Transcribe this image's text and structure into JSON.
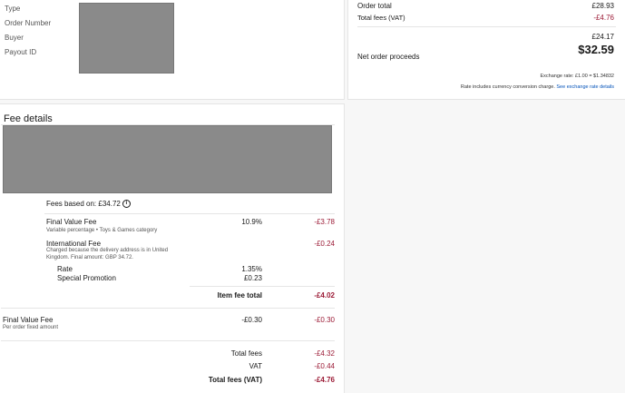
{
  "order_info": {
    "labels": {
      "type": "Type",
      "order_number": "Order Number",
      "buyer": "Buyer",
      "payout_id": "Payout ID"
    }
  },
  "summary": {
    "order_total_label": "Order total",
    "order_total_value": "£28.93",
    "total_fees_vat_label": "Total fees (VAT)",
    "total_fees_vat_value": "-£4.76",
    "subtotal_value": "£24.17",
    "net_proceeds_label": "Net order proceeds",
    "net_proceeds_value": "$32.59",
    "exchange_rate": "Exchange rate: £1.00 = $1.34832",
    "rate_note": "Rate includes currency conversion charge.",
    "rate_link": "See exchange rate details"
  },
  "fee_details": {
    "title": "Fee details",
    "fees_based_on": "Fees based on: £34.72",
    "final_value_fee": {
      "name": "Final Value Fee",
      "desc": "Variable percentage • Toys & Games category",
      "rate": "10.9%",
      "amount": "-£3.78"
    },
    "international_fee": {
      "name": "International Fee",
      "desc_line1": "Charged because the delivery address is in United",
      "desc_line2": "Kingdom. Final amount: GBP 34.72.",
      "amount": "-£0.24",
      "rate_label": "Rate",
      "rate_value": "1.35%",
      "promo_label": "Special Promotion",
      "promo_value": "£0.23"
    },
    "item_fee_total_label": "Item fee total",
    "item_fee_total_value": "-£4.02",
    "fixed_fee": {
      "name": "Final Value Fee",
      "desc": "Per order fixed amount",
      "rate": "-£0.30",
      "amount": "-£0.30"
    },
    "totals": {
      "total_fees_label": "Total fees",
      "total_fees_value": "-£4.32",
      "vat_label": "VAT",
      "vat_value": "-£0.44",
      "total_fees_vat_label": "Total fees (VAT)",
      "total_fees_vat_value": "-£4.76"
    }
  },
  "colors": {
    "negative": "#9c1c37",
    "link": "#0654ba",
    "redaction": "#8a8a8a"
  }
}
